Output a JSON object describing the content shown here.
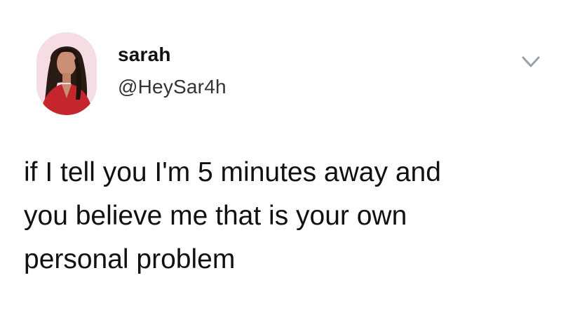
{
  "author": {
    "display_name": "sarah",
    "handle": "@HeySar4h",
    "avatar_icon": "profile-photo"
  },
  "menu_icon": "chevron-down-icon",
  "tweet": {
    "lines": [
      "if I tell you I'm 5 minutes away and",
      "you believe me that is your own",
      "personal problem"
    ]
  },
  "colors": {
    "background": "#ffffff",
    "text": "#111111",
    "handle": "#333333",
    "chevron": "#9aa3ab"
  }
}
